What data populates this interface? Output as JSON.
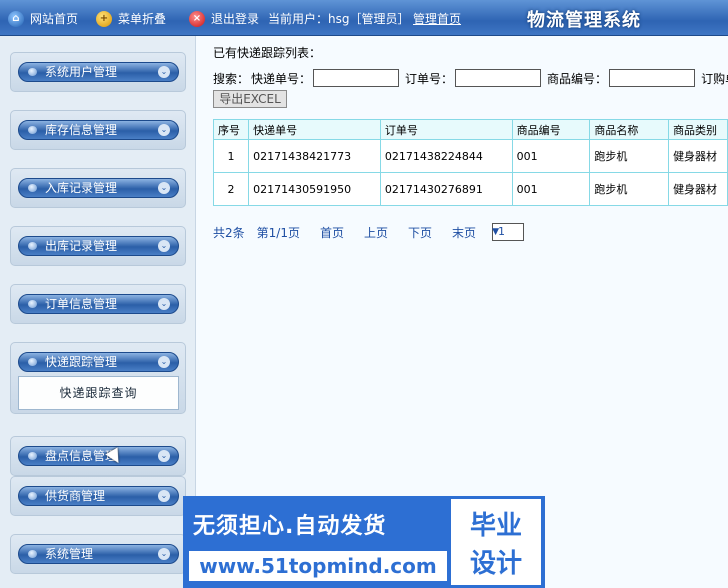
{
  "topbar": {
    "site_home": "网站首页",
    "menu_fold": "菜单折叠",
    "logout": "退出登录",
    "current_user": "当前用户：hsg［管理员］",
    "admin_home": "管理首页",
    "system_title": "物流管理系统"
  },
  "sidebar": {
    "items": [
      {
        "label": "系统用户管理"
      },
      {
        "label": "库存信息管理"
      },
      {
        "label": "入库记录管理"
      },
      {
        "label": "出库记录管理"
      },
      {
        "label": "订单信息管理"
      },
      {
        "label": "快递跟踪管理"
      },
      {
        "label": "盘点信息管理"
      },
      {
        "label": "供货商管理"
      },
      {
        "label": "系统管理"
      }
    ],
    "submenu": "快递跟踪查询"
  },
  "main": {
    "caption": "已有快递跟踪列表：",
    "search_label": "搜索：",
    "search_fields": [
      "快递单号：",
      "订单号：",
      "商品编号：",
      "订购单位"
    ],
    "export_button": "导出EXCEL",
    "table": {
      "headers": [
        "序号",
        "快递单号",
        "订单号",
        "商品编号",
        "商品名称",
        "商品类别"
      ],
      "rows": [
        [
          "1",
          "02171438421773",
          "02171438224844",
          "001",
          "跑步机",
          "健身器材"
        ],
        [
          "2",
          "02171430591950",
          "02171430276891",
          "001",
          "跑步机",
          "健身器材"
        ]
      ]
    },
    "pager": {
      "total": "共2条",
      "page_info": "第1/1页",
      "first": "首页",
      "prev": "上页",
      "next": "下页",
      "last": "末页",
      "select_value": "1"
    }
  },
  "watermark": {
    "line1": "无须担心.自动发货",
    "line2": "www.51topmind.com",
    "right1": "毕业",
    "right2": "设计"
  }
}
